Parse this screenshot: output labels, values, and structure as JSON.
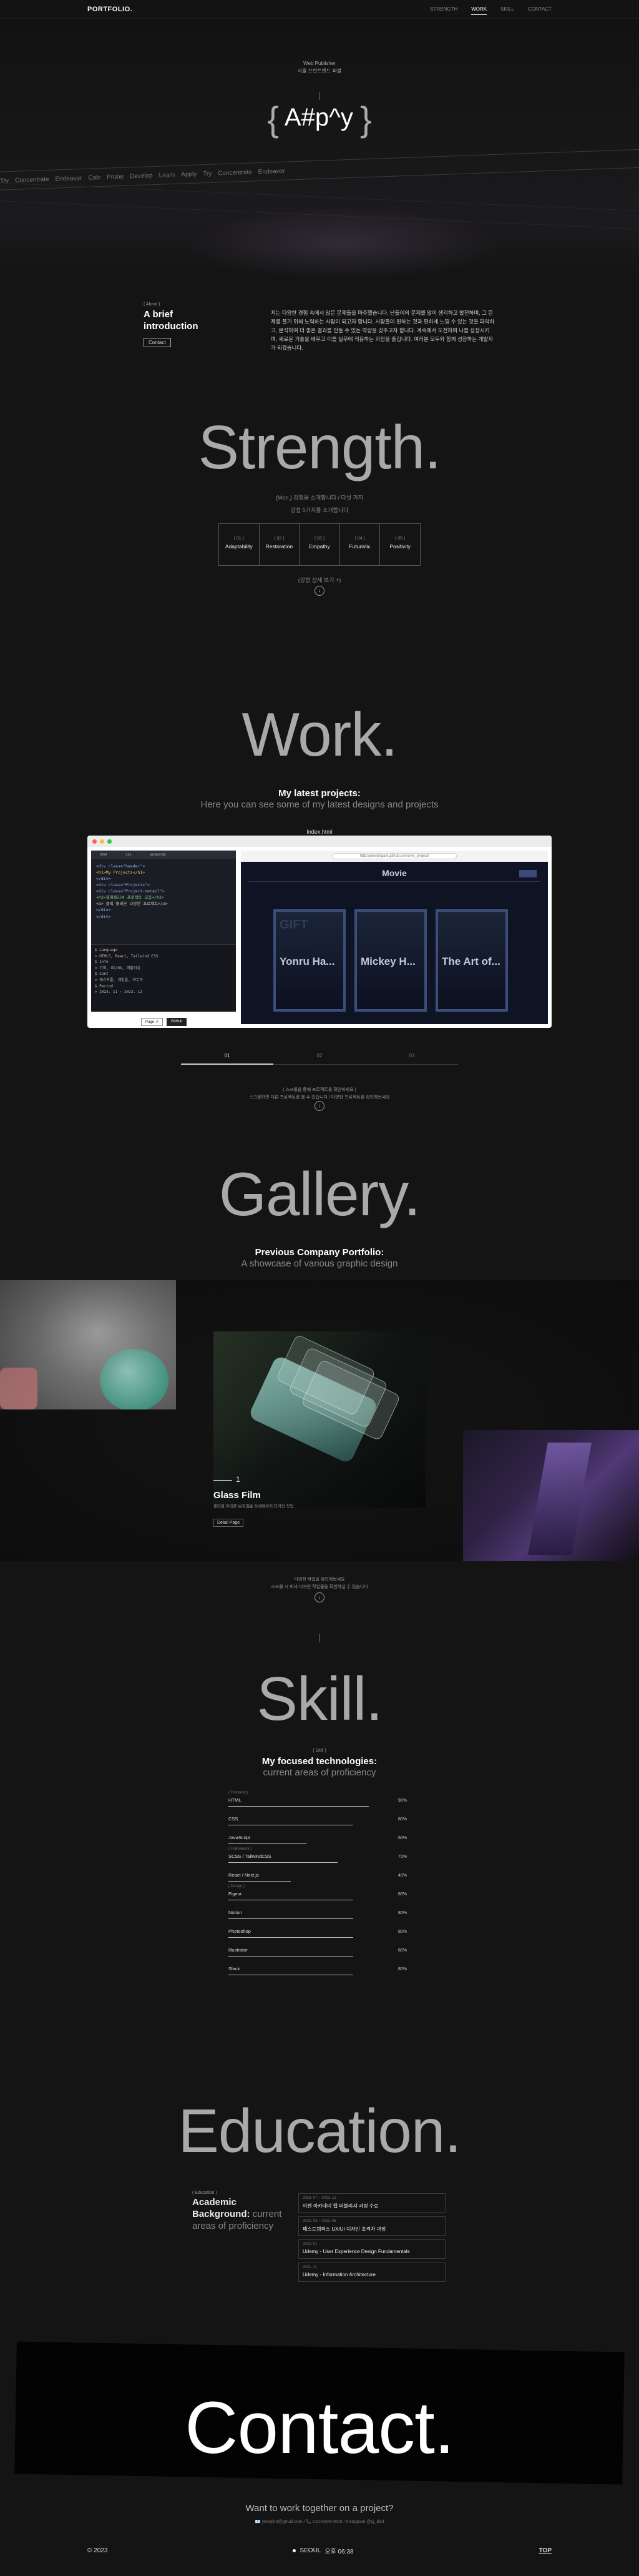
{
  "header": {
    "logo": "PORTFOLIO.",
    "nav": [
      "STRENGTH",
      "WORK",
      "SKILL",
      "CONTACT"
    ],
    "active_index": 1
  },
  "hero": {
    "intro_line1": "Web Publisher",
    "intro_line2": "서울 프런트엔드 퍼블",
    "title": "A#p^y",
    "brace_left": "{",
    "brace_right": "}",
    "marquee": [
      "Try",
      "Concentrate",
      "Endeavor",
      "Calc",
      "Probe",
      "Develop",
      "Learn",
      "Apply",
      "Try",
      "Concentrate",
      "Endeavor"
    ]
  },
  "about": {
    "label": "( About )",
    "title_line1": "A brief",
    "title_line2": "introduction",
    "button": "Contact",
    "text": "저는 다양한 경험 속에서 많은 문제들을 마주했습니다. 난들이의 문제를 많이 생각하고 발전하며, 그 문제를 풀기 위해 노력하는 사람이 되고자 합니다. 사람들이 원하는 것과 편하게 느낄 수 있는 것을 파악하고, 분석하여 더 좋은 결과를 만들 수 있는 역량을 갖추고자 합니다. 계속해서 도전하며 나를 성장시키며, 새로운 기술을 배우고 이를 실무에 적용하는 과정을 즐깁니다. 여러분 모두와 함께 성장하는 개발자가 되겠습니다."
  },
  "strength": {
    "title": "Strength.",
    "sub1": "(Mon.) 강점을 소개합니다 / 다섯 가지",
    "sub2": "강점 5가지를 소개합니다",
    "cards": [
      {
        "n": "( 01 )",
        "t": "Adaptability"
      },
      {
        "n": "( 02 )",
        "t": "Restoration"
      },
      {
        "n": "( 03 )",
        "t": "Empathy"
      },
      {
        "n": "( 04 )",
        "t": "Futuristic"
      },
      {
        "n": "( 05 )",
        "t": "Positivity"
      }
    ],
    "more": "(강점 상세 보기 +)",
    "icon": "↓"
  },
  "work": {
    "title": "Work.",
    "heading": "My latest projects:",
    "subheading": "Here you can see some of my latest designs and projects",
    "window_title": "Index.html",
    "editor_tabs": [
      "html",
      "css",
      "javascript"
    ],
    "code": [
      "<div class=\"header\">",
      "  <h1>My Projects</h1>",
      "</div>",
      "<div class=\"Projects\">",
      "  <div class=\"Project-detail\">",
      "    <h2>웹퍼블리셔 프로젝트 모음</h2>",
      "    <a> 클릭 둘러본 다양한 프로젝트</a>",
      "  </div>",
      "</div>"
    ],
    "terminal": [
      "$ Language",
      "> HTML5, React, Tailwind CSS",
      "$ Info",
      "> 기획, UI/UX, 퍼블리싱",
      "$ Cont",
      "> 제스처를, 개발을, 마무리",
      "$ Period",
      "> 2023. 11 ~ 2023. 12"
    ],
    "url": "http://yeonjinpark.github.io/movie_project/",
    "movie_title": "Movie",
    "posters": [
      "Yonru Ha...",
      "Mickey H...",
      "The Art of..."
    ],
    "buttons": [
      "Page ↗",
      "GitHub"
    ],
    "tabs": [
      "01",
      "02",
      "03"
    ],
    "bottom_text1": "( 스크롤을 통해 프로젝트를 확인하세요 )",
    "bottom_text2": "스크롤하면 다른 프로젝트를 볼 수 있습니다 / 다양한 프로젝트를 확인해보세요",
    "icon": "↓"
  },
  "gallery": {
    "title": "Gallery.",
    "heading": "Previous Company Portfolio:",
    "subheading": "A showcase of various graphic design",
    "item_no": "1",
    "item_title": "Glass Film",
    "item_desc": "폴더블 휴대폰 보호필름 상세페이지 디자인 작업",
    "item_button": "Detail Page",
    "bottom_text1": "다양한 작업을 확인해보세요",
    "bottom_text2": "스크롤 시 회사 디자인 작업물을 확인하실 수 있습니다",
    "icon": "↓"
  },
  "skill": {
    "title": "Skill.",
    "label": "( Skill )",
    "heading": "My focused technologies:",
    "subheading": "current areas of proficiency",
    "items": [
      {
        "cat": "( Frontend )",
        "name": "HTML",
        "value": "90%",
        "pct": 90
      },
      {
        "cat": "",
        "name": "CSS",
        "value": "80%",
        "pct": 80
      },
      {
        "cat": "",
        "name": "JavaScript",
        "value": "50%",
        "pct": 50
      },
      {
        "cat": "( Framework )",
        "name": "SCSS / TailwindCSS",
        "value": "70%",
        "pct": 70
      },
      {
        "cat": "",
        "name": "React / Next.js",
        "value": "40%",
        "pct": 40
      },
      {
        "cat": "( Design )",
        "name": "Figma",
        "value": "80%",
        "pct": 80
      },
      {
        "cat": "",
        "name": "Notion",
        "value": "80%",
        "pct": 80
      },
      {
        "cat": "",
        "name": "Photoshop",
        "value": "80%",
        "pct": 80
      },
      {
        "cat": "",
        "name": "Illustrator",
        "value": "80%",
        "pct": 80
      },
      {
        "cat": "",
        "name": "Slack",
        "value": "80%",
        "pct": 80
      }
    ]
  },
  "education": {
    "title": "Education.",
    "label": "( Education )",
    "heading_line1": "Academic",
    "heading_line2": "Background:",
    "heading_muted1": "current",
    "heading_muted2": "areas of proficiency",
    "items": [
      {
        "d": "2023. 07 ~ 2023. 12",
        "t": "이젠 아카데미 웹 퍼블리셔 과정 수료"
      },
      {
        "d": "2022. 03 ~ 2022. 06",
        "t": "패스트캠퍼스 UX/UI 디자인 초격차 과정"
      },
      {
        "d": "2022. 01",
        "t": "Udemy - User Experience Design Fundamentals"
      },
      {
        "d": "2021. 11",
        "t": "Udemy - Information Architecture"
      }
    ]
  },
  "contact": {
    "title": "Contact.",
    "heading": "Want to work together on a project?",
    "sub": "📧 yeonjin0@gmail.com / 📞 010-0000-0000 / Instagram @yj_bird"
  },
  "footer": {
    "copyright": "© 2023",
    "city": "SEOUL",
    "time": "오후 06:38",
    "top": "TOP"
  }
}
